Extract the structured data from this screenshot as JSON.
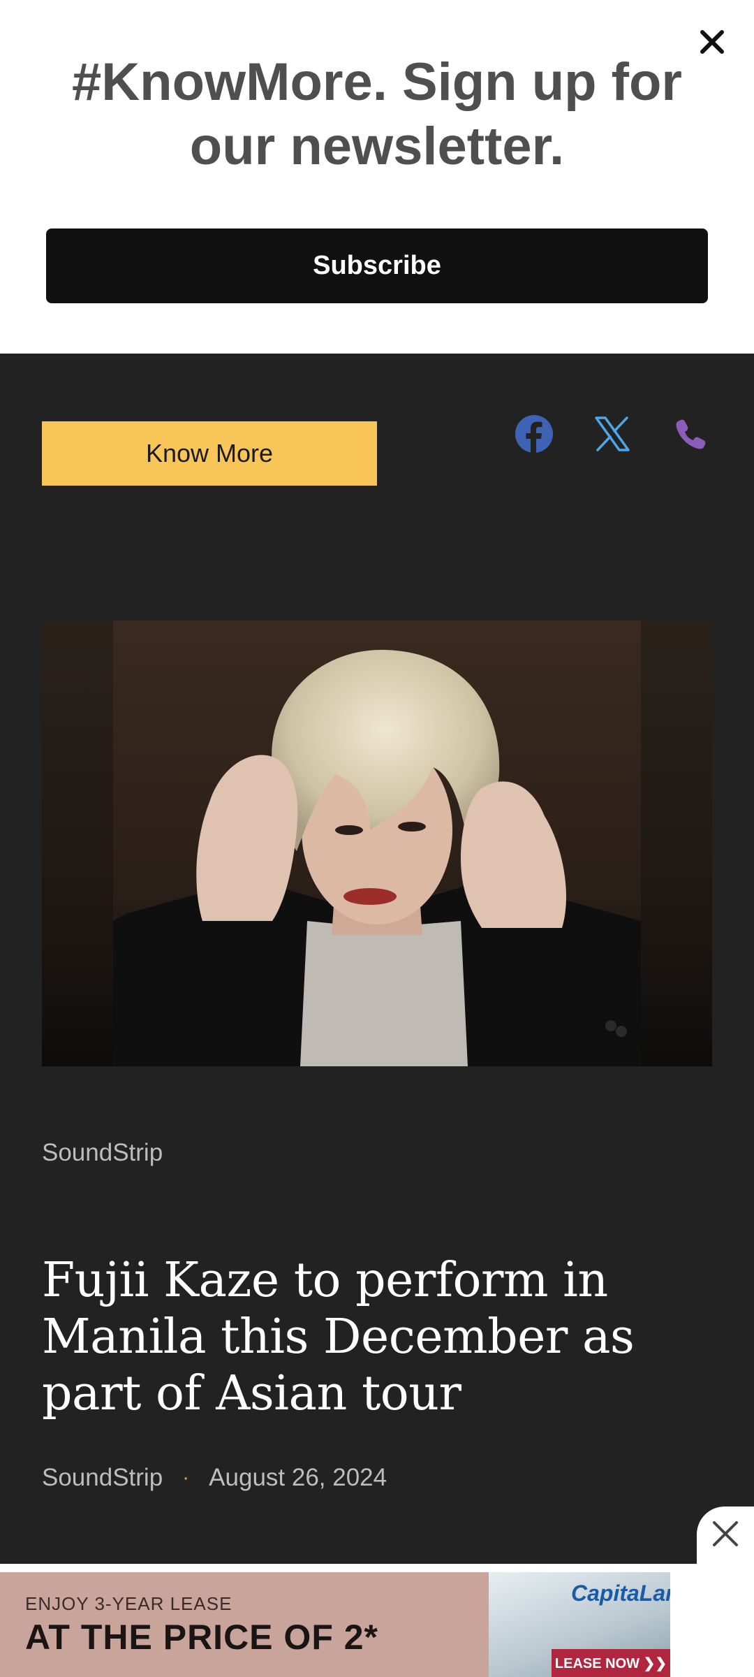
{
  "newsletter": {
    "title": "#KnowMore. Sign up for our newsletter.",
    "subscribe_label": "Subscribe"
  },
  "header": {
    "know_more_label": "Know More",
    "social_icons": [
      "facebook-icon",
      "x-icon",
      "phone-icon"
    ],
    "colors": {
      "know_more_bg": "#f7c558",
      "facebook": "#3f63b4",
      "x": "#4ca6e8",
      "phone": "#8b5cb8"
    }
  },
  "article": {
    "category": "SoundStrip",
    "headline": "Fujii Kaze to perform in Manila this December as part of Asian tour",
    "byline": {
      "author": "SoundStrip",
      "separator": "·",
      "date": "August 26, 2024"
    }
  },
  "ad": {
    "line1": "ENJOY 3-YEAR LEASE",
    "line2": "AT THE PRICE OF 2*",
    "brand": "CapitaLand",
    "cta": "LEASE NOW ❯❯"
  }
}
